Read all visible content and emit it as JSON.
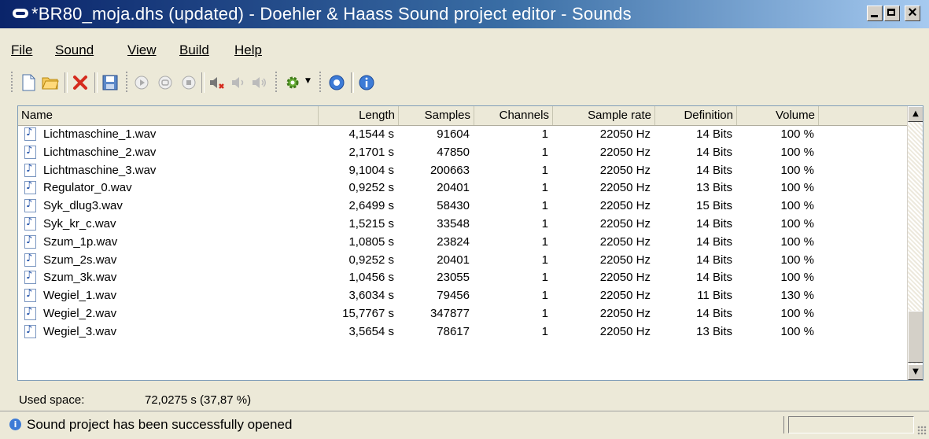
{
  "window": {
    "title": "*BR80_moja.dhs (updated) - Doehler & Haass Sound project editor - Sounds",
    "controls": [
      "minimize",
      "maximize",
      "close"
    ]
  },
  "menu": [
    "File",
    "Sound",
    "View",
    "Build",
    "Help"
  ],
  "toolbar": {
    "icons": [
      "new-file-icon",
      "open-folder-icon",
      "delete-icon",
      "save-icon",
      "play-icon",
      "loop-icon",
      "stop-icon",
      "sound-on-icon",
      "sound-mute-icon",
      "sound-icon",
      "settings-gear-icon",
      "help-icon",
      "info-icon"
    ]
  },
  "columns": [
    "Name",
    "Length",
    "Samples",
    "Channels",
    "Sample rate",
    "Definition",
    "Volume"
  ],
  "rows": [
    {
      "name": "Lichtmaschine_1.wav",
      "length": "4,1544 s",
      "samples": "91604",
      "channels": "1",
      "rate": "22050 Hz",
      "definition": "14 Bits",
      "volume": "100 %"
    },
    {
      "name": "Lichtmaschine_2.wav",
      "length": "2,1701 s",
      "samples": "47850",
      "channels": "1",
      "rate": "22050 Hz",
      "definition": "14 Bits",
      "volume": "100 %"
    },
    {
      "name": "Lichtmaschine_3.wav",
      "length": "9,1004 s",
      "samples": "200663",
      "channels": "1",
      "rate": "22050 Hz",
      "definition": "14 Bits",
      "volume": "100 %"
    },
    {
      "name": "Regulator_0.wav",
      "length": "0,9252 s",
      "samples": "20401",
      "channels": "1",
      "rate": "22050 Hz",
      "definition": "13 Bits",
      "volume": "100 %"
    },
    {
      "name": "Syk_dlug3.wav",
      "length": "2,6499 s",
      "samples": "58430",
      "channels": "1",
      "rate": "22050 Hz",
      "definition": "15 Bits",
      "volume": "100 %"
    },
    {
      "name": "Syk_kr_c.wav",
      "length": "1,5215 s",
      "samples": "33548",
      "channels": "1",
      "rate": "22050 Hz",
      "definition": "14 Bits",
      "volume": "100 %"
    },
    {
      "name": "Szum_1p.wav",
      "length": "1,0805 s",
      "samples": "23824",
      "channels": "1",
      "rate": "22050 Hz",
      "definition": "14 Bits",
      "volume": "100 %"
    },
    {
      "name": "Szum_2s.wav",
      "length": "0,9252 s",
      "samples": "20401",
      "channels": "1",
      "rate": "22050 Hz",
      "definition": "14 Bits",
      "volume": "100 %"
    },
    {
      "name": "Szum_3k.wav",
      "length": "1,0456 s",
      "samples": "23055",
      "channels": "1",
      "rate": "22050 Hz",
      "definition": "14 Bits",
      "volume": "100 %"
    },
    {
      "name": "Wegiel_1.wav",
      "length": "3,6034 s",
      "samples": "79456",
      "channels": "1",
      "rate": "22050 Hz",
      "definition": "11 Bits",
      "volume": "130 %"
    },
    {
      "name": "Wegiel_2.wav",
      "length": "15,7767 s",
      "samples": "347877",
      "channels": "1",
      "rate": "22050 Hz",
      "definition": "14 Bits",
      "volume": "100 %"
    },
    {
      "name": "Wegiel_3.wav",
      "length": "3,5654 s",
      "samples": "78617",
      "channels": "1",
      "rate": "22050 Hz",
      "definition": "13 Bits",
      "volume": "100 %"
    }
  ],
  "summary": {
    "used_label": "Used space:",
    "used_value": "72,0275 s (37,87 %)"
  },
  "status": {
    "message": "Sound project has been successfully opened"
  },
  "colors": {
    "title_start": "#0a246a",
    "title_end": "#a6caf0",
    "face": "#ece9d8",
    "list_bg": "#ffffff"
  }
}
